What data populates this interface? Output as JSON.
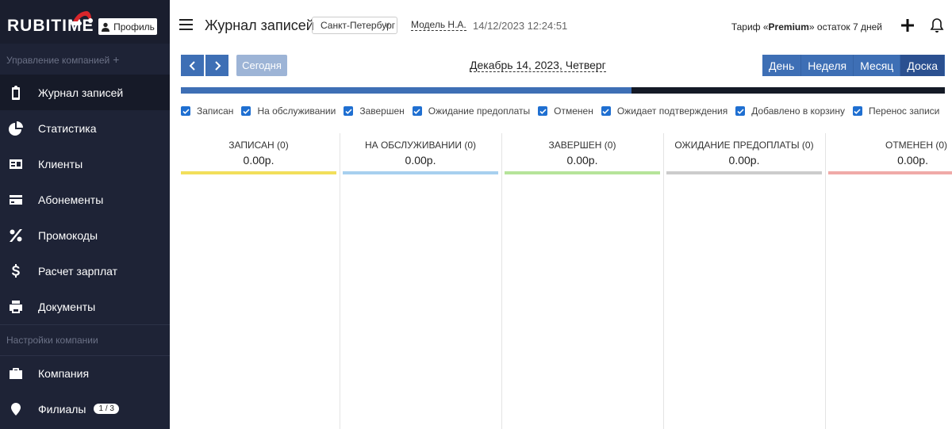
{
  "sidebar": {
    "logo": "RUBITIME",
    "profile_label": "Профиль",
    "section_manage": "Управление компанией",
    "section_settings": "Настройки компании",
    "items": [
      {
        "label": "Журнал записей"
      },
      {
        "label": "Статистика"
      },
      {
        "label": "Клиенты"
      },
      {
        "label": "Абонементы"
      },
      {
        "label": "Промокоды"
      },
      {
        "label": "Расчет зарплат"
      },
      {
        "label": "Документы"
      },
      {
        "label": "Компания"
      },
      {
        "label": "Филиалы",
        "badge": "1 / 3"
      }
    ]
  },
  "topbar": {
    "title": "Журнал записей",
    "branch": "Санкт-Петербург",
    "user": "Модель Н.А.",
    "datetime": "14/12/2023 12:24:51",
    "tariff_prefix": "Тариф «",
    "tariff_name": "Premium",
    "tariff_suffix": "» остаток 7 дней"
  },
  "toolbar": {
    "today_label": "Сегодня",
    "date_label": "Декабрь 14, 2023, Четверг",
    "views": [
      "День",
      "Неделя",
      "Месяц",
      "Доска"
    ],
    "selected_view": "Доска"
  },
  "progress": {
    "fraction": 0.59,
    "fill_color": "#3e6fb5",
    "track_color": "#141a26"
  },
  "filters": [
    {
      "label": "Записан",
      "checked": true
    },
    {
      "label": "На обслуживании",
      "checked": true
    },
    {
      "label": "Завершен",
      "checked": true
    },
    {
      "label": "Ожидание предоплаты",
      "checked": true
    },
    {
      "label": "Отменен",
      "checked": true
    },
    {
      "label": "Ожидает подтверждения",
      "checked": true
    },
    {
      "label": "Добавлено в корзину",
      "checked": true
    },
    {
      "label": "Перенос записи",
      "checked": true
    }
  ],
  "board": {
    "columns": [
      {
        "title": "ЗАПИСАН (0)",
        "sum": "0.00р.",
        "color": "#f2df5b"
      },
      {
        "title": "НА ОБСЛУЖИВАНИИ (0)",
        "sum": "0.00р.",
        "color": "#a7d0ef"
      },
      {
        "title": "ЗАВЕРШЕН (0)",
        "sum": "0.00р.",
        "color": "#b6e49a"
      },
      {
        "title": "ОЖИДАНИЕ ПРЕДОПЛАТЫ (0)",
        "sum": "0.00р.",
        "color": "#cccccc"
      },
      {
        "title": "ОТМЕНЕН (0)",
        "sum": "0.00р.",
        "color": "#f0aaa8"
      }
    ]
  }
}
